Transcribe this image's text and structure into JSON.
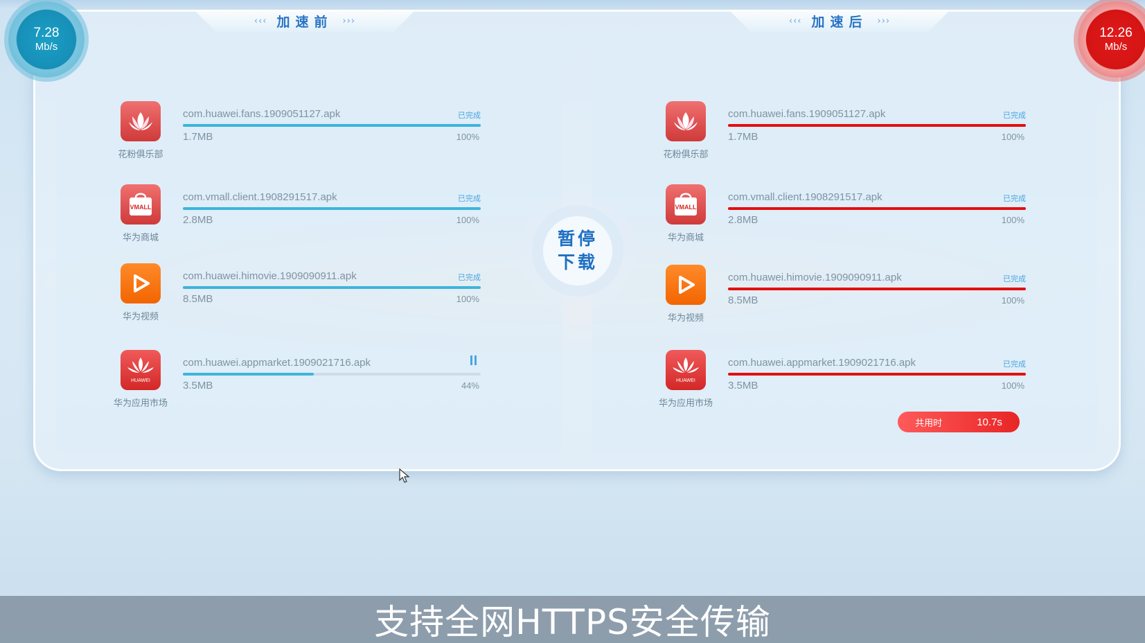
{
  "header": {
    "before_title": "加速前",
    "after_title": "加速后",
    "arrow_left": "‹‹‹",
    "arrow_right": "›››"
  },
  "speed": {
    "before": {
      "value": "7.28",
      "unit": "Mb/s"
    },
    "after": {
      "value": "12.26",
      "unit": "Mb/s"
    }
  },
  "center_button": {
    "line1": "暂停",
    "line2": "下载"
  },
  "before_items": [
    {
      "app": "花粉俱乐部",
      "file": "com.huawei.fans.1909051127.apk",
      "size": "1.7MB",
      "status": "已完成",
      "percent": "100%",
      "progress": 1.0,
      "icon": "huawei-fans-icon"
    },
    {
      "app": "华为商城",
      "file": "com.vmall.client.1908291517.apk",
      "size": "2.8MB",
      "status": "已完成",
      "percent": "100%",
      "progress": 1.0,
      "icon": "vmall-icon"
    },
    {
      "app": "华为视频",
      "file": "com.huawei.himovie.1909090911.apk",
      "size": "8.5MB",
      "status": "已完成",
      "percent": "100%",
      "progress": 1.0,
      "icon": "huawei-video-icon"
    },
    {
      "app": "华为应用市场",
      "file": "com.huawei.appmarket.1909021716.apk",
      "size": "3.5MB",
      "status": "",
      "percent": "44%",
      "progress": 0.44,
      "icon": "huawei-appmarket-icon"
    }
  ],
  "after_items": [
    {
      "app": "花粉俱乐部",
      "file": "com.huawei.fans.1909051127.apk",
      "size": "1.7MB",
      "status": "已完成",
      "percent": "100%",
      "progress": 1.0,
      "icon": "huawei-fans-icon"
    },
    {
      "app": "华为商城",
      "file": "com.vmall.client.1908291517.apk",
      "size": "2.8MB",
      "status": "已完成",
      "percent": "100%",
      "progress": 1.0,
      "icon": "vmall-icon"
    },
    {
      "app": "华为视频",
      "file": "com.huawei.himovie.1909090911.apk",
      "size": "8.5MB",
      "status": "已完成",
      "percent": "100%",
      "progress": 1.0,
      "icon": "huawei-video-icon"
    },
    {
      "app": "华为应用市场",
      "file": "com.huawei.appmarket.1909021716.apk",
      "size": "3.5MB",
      "status": "已完成",
      "percent": "100%",
      "progress": 1.0,
      "icon": "huawei-appmarket-icon"
    }
  ],
  "total_time": {
    "label": "共用时",
    "value": "10.7s"
  },
  "caption": "支持全网HTTPS安全传输",
  "icon_text": {
    "vmall": "VMALL",
    "huawei": "HUAWEI"
  },
  "colors": {
    "before_accent": "#3db5db",
    "after_accent": "#e30f0f",
    "title_blue": "#2a74c4"
  }
}
